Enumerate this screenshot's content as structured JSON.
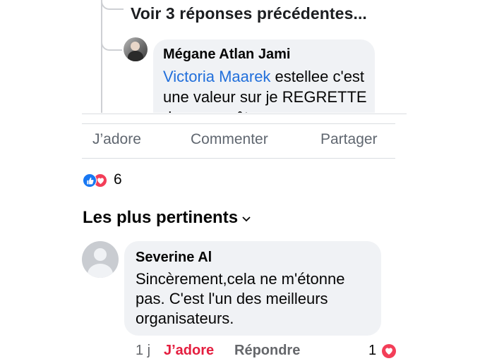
{
  "replies": {
    "view_previous_label": "Voir 3 réponses précédentes...",
    "visible_reply": {
      "author": "Mégane Atlan Jami",
      "mention": "Victoria Maarek",
      "text_after_mention": " estellee c'est une valeur sur je",
      "text_cutoff": "REGRETTE de ne pas être"
    }
  },
  "actions": {
    "like_label": "J’adore",
    "comment_label": "Commenter",
    "share_label": "Partager"
  },
  "reactions": {
    "icons": [
      "like-icon",
      "love-icon"
    ],
    "count": "6"
  },
  "sort": {
    "label": "Les plus pertinents",
    "icon": "chevron-down-icon"
  },
  "comment": {
    "author": "Severine Al",
    "text": "Sincèrement,cela ne m'étonne pas. C'est l'un des meilleurs organisateurs.",
    "time": "1 j",
    "like_label": "J’adore",
    "reply_label": "Répondre",
    "reaction_count": "1",
    "reaction_icon": "love-icon"
  },
  "colors": {
    "bubble_bg": "#f0f2f5",
    "mention_blue": "#216fdb",
    "like_red": "#e41e3f",
    "love_red": "#f33e58",
    "like_blue": "#1877f2",
    "muted_text": "#65676b"
  }
}
